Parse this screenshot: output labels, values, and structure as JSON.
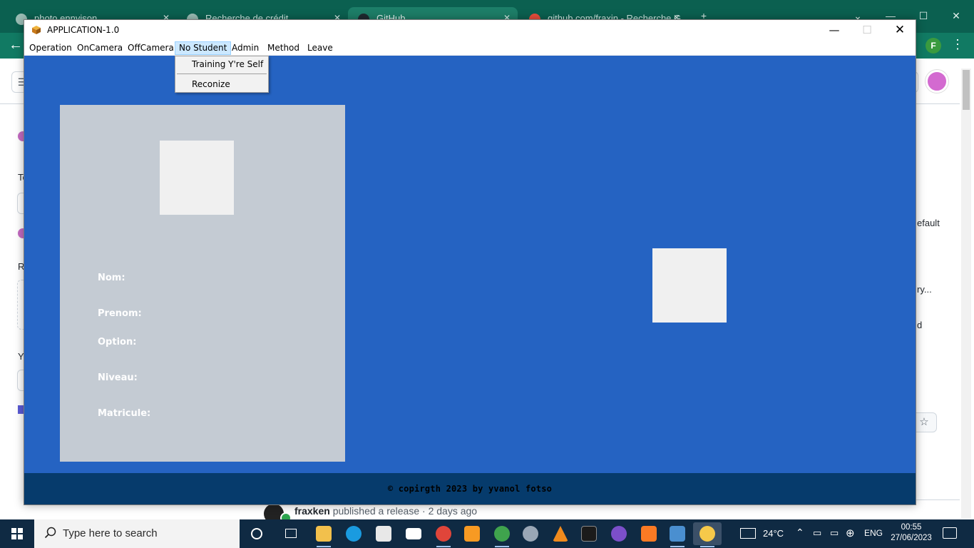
{
  "browser": {
    "tabs": [
      {
        "label": "photo ennvison"
      },
      {
        "label": "Recherche de crédit"
      },
      {
        "label": "GitHub"
      },
      {
        "label": "github.com/fraxin - Recherche G"
      }
    ],
    "new_tab": "+",
    "profile_initial": "F",
    "page_fragments": {
      "right_default": "efault",
      "right_try": "ry...",
      "right_d": "d",
      "left_t": "Te",
      "left_r": "R",
      "left_y": "Y"
    },
    "release": {
      "user": "fraxken",
      "text": "published a release · 2 days ago"
    }
  },
  "app": {
    "title": "APPLICATION-1.0",
    "menu": [
      {
        "label": "Operation"
      },
      {
        "label": "OnCamera"
      },
      {
        "label": "OffCamera"
      },
      {
        "label": "No Student"
      },
      {
        "label": "Admin"
      },
      {
        "label": "Method"
      },
      {
        "label": "Leave"
      }
    ],
    "dropdown": {
      "items": [
        {
          "label": "Training Y're Self"
        },
        {
          "label": "Reconize"
        }
      ]
    },
    "fields": [
      {
        "label": "Nom:"
      },
      {
        "label": "Prenom:"
      },
      {
        "label": "Option:"
      },
      {
        "label": "Niveau:"
      },
      {
        "label": "Matricule:"
      }
    ],
    "footer": "© copirgth 2023 by yvanol fotso",
    "colors": {
      "background": "#2563c2",
      "panel": "#c4cbd3",
      "footer": "#063b6c"
    }
  },
  "taskbar": {
    "search_placeholder": "Type here to search",
    "weather": "24°C",
    "language": "ENG",
    "time": "00:55",
    "date": "27/06/2023",
    "icons": [
      "task-view-icon",
      "file-explorer-icon",
      "edge-icon",
      "store-icon",
      "mail-icon",
      "chrome-icon",
      "sublime-icon",
      "chrome-icon",
      "settings-icon",
      "vlc-icon",
      "terminal-icon",
      "github-desktop-icon",
      "xampp-icon",
      "python-idle-icon",
      "python-icon"
    ]
  }
}
